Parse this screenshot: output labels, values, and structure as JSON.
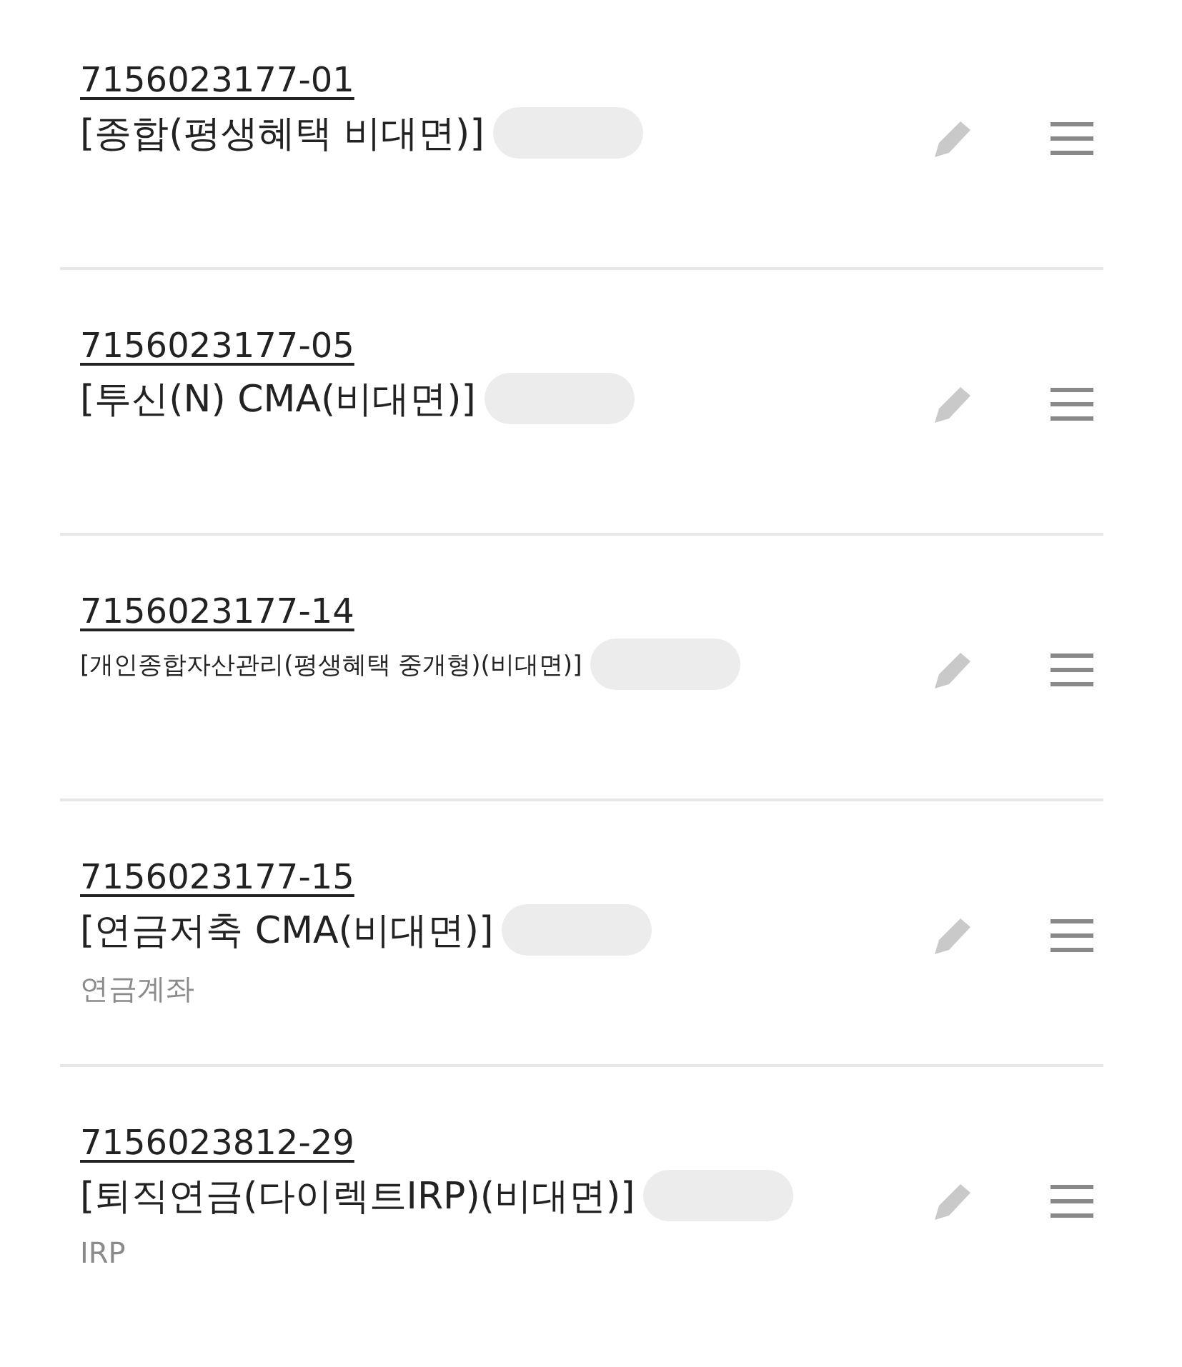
{
  "accounts": [
    {
      "number": "7156023177-01",
      "name": "[종합(평생혜택 비대면)]",
      "redacted": true
    },
    {
      "number": "7156023177-05",
      "name": "[투신(N) CMA(비대면)]",
      "redacted": true
    },
    {
      "number": "7156023177-14",
      "name": "[개인종합자산관리(평생혜택 중개형)(비대면)]",
      "redacted": true
    },
    {
      "number": "7156023177-15",
      "name": "[연금저축 CMA(비대면)]",
      "redacted": true,
      "type": "연금계좌"
    },
    {
      "number": "7156023812-29",
      "name": "[퇴직연금(다이렉트IRP)(비대면)]",
      "redacted": true,
      "type": "IRP"
    }
  ]
}
